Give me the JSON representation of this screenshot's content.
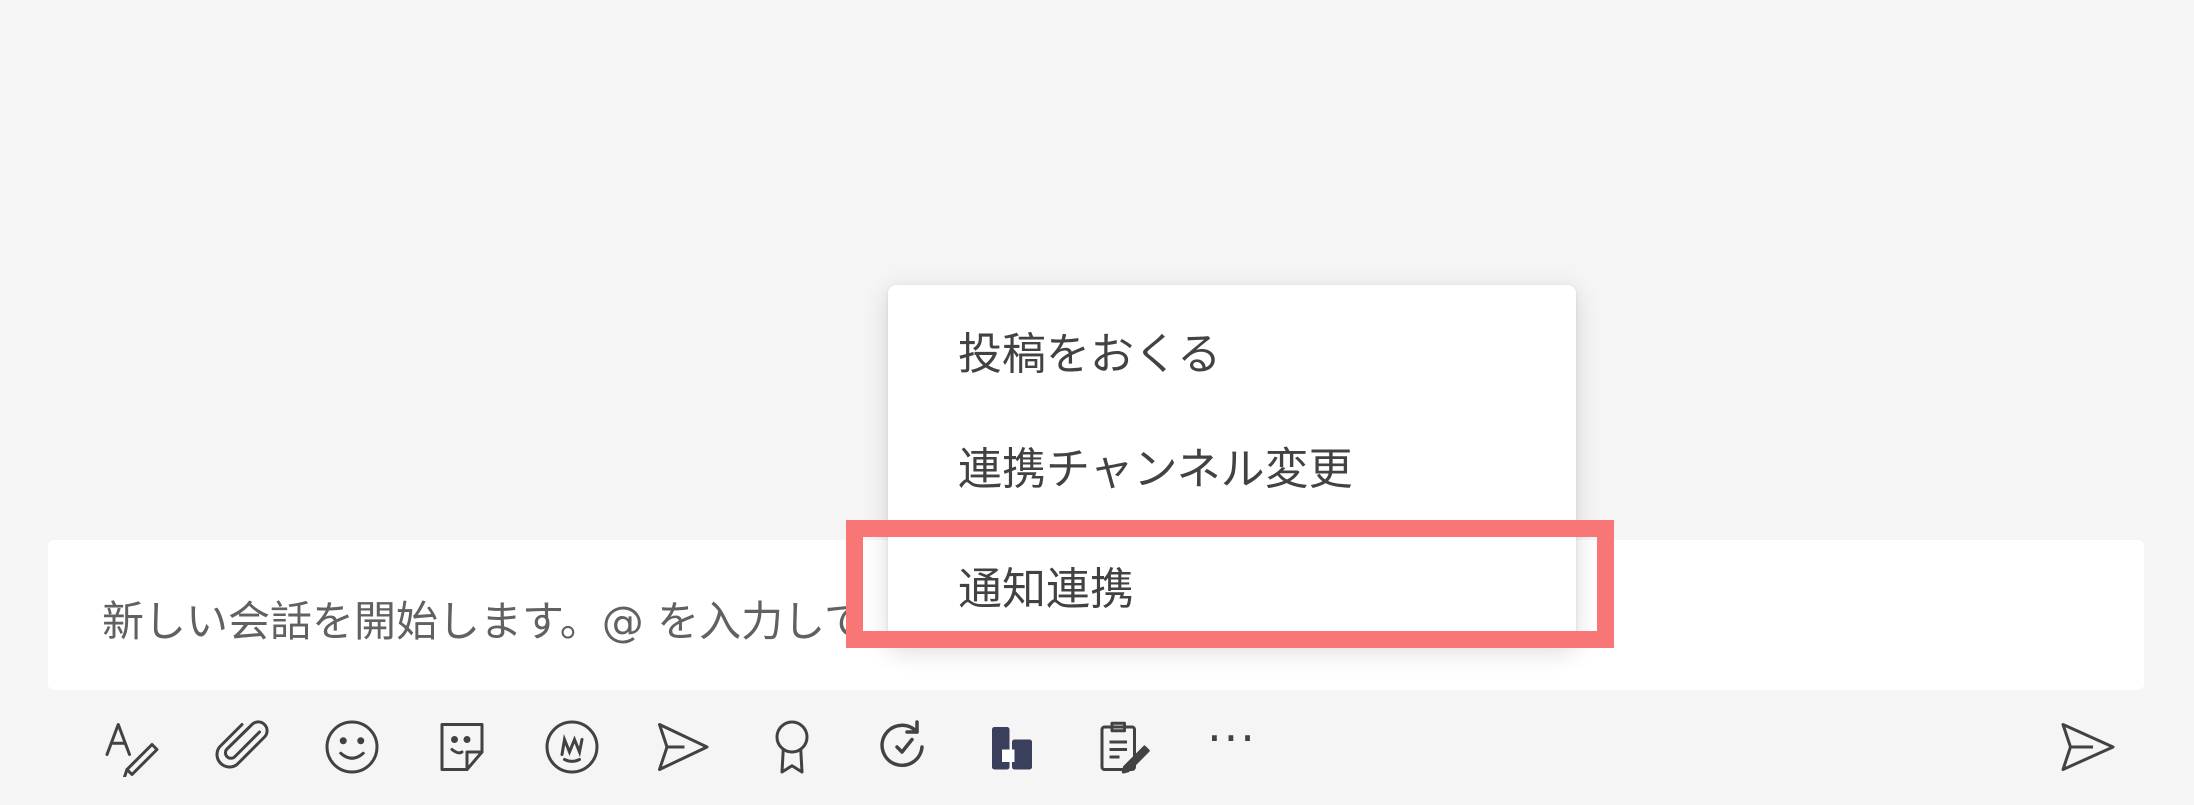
{
  "compose": {
    "placeholder": "新しい会話を開始します。@ を入力して"
  },
  "menu": {
    "items": [
      {
        "label": "投稿をおくる"
      },
      {
        "label": "連携チャンネル変更"
      },
      {
        "label": "通知連携"
      }
    ]
  },
  "toolbar": {
    "more_label": "···",
    "buttons": [
      {
        "icon": "format-icon"
      },
      {
        "icon": "attach-icon"
      },
      {
        "icon": "emoji-icon"
      },
      {
        "icon": "sticker-icon"
      },
      {
        "icon": "gif-icon"
      },
      {
        "icon": "schedule-send-icon"
      },
      {
        "icon": "praise-icon"
      },
      {
        "icon": "loop-icon"
      },
      {
        "icon": "app-icon"
      },
      {
        "icon": "forms-icon"
      },
      {
        "icon": "more-options-icon"
      },
      {
        "icon": "send-icon"
      }
    ]
  },
  "highlight": {
    "color": "#f87676",
    "target": "通知連携"
  }
}
